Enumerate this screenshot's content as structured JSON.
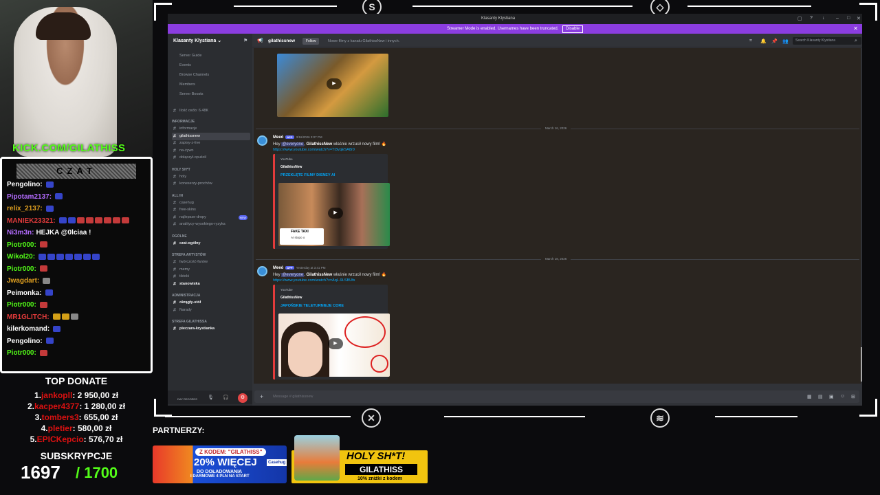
{
  "overlay": {
    "kick_url": "KICK.COM/GILATHISS",
    "chat_title": "CZAT",
    "chat": [
      {
        "user": "Pengolino:",
        "color": "#ffffff",
        "msg": "",
        "emotes": [
          "b"
        ]
      },
      {
        "user": "Pipotam2137:",
        "color": "#b46cff",
        "msg": "",
        "emotes": [
          "b"
        ]
      },
      {
        "user": "relix_2137:",
        "color": "#e0a020",
        "msg": "",
        "emotes": [
          "b"
        ]
      },
      {
        "user": "MANIEK23321:",
        "color": "#e23b3b",
        "msg": "",
        "emotes": [
          "b",
          "b",
          "r",
          "r",
          "r",
          "r",
          "r",
          "r"
        ]
      },
      {
        "user": "Ni3m3n:",
        "color": "#b46cff",
        "msg": "HEJKA @0lciaa !",
        "emotes": []
      },
      {
        "user": "Piotr000:",
        "color": "#53fc18",
        "msg": "",
        "emotes": [
          "r"
        ]
      },
      {
        "user": "Wikol20:",
        "color": "#53fc18",
        "msg": "",
        "emotes": [
          "b",
          "b",
          "b",
          "b",
          "b",
          "b",
          "b"
        ]
      },
      {
        "user": "Piotr000:",
        "color": "#53fc18",
        "msg": "",
        "emotes": [
          "r"
        ]
      },
      {
        "user": "Jwagdart:",
        "color": "#e0a020",
        "msg": "",
        "emotes": [
          "g"
        ]
      },
      {
        "user": "Peimonka:",
        "color": "#ffffff",
        "msg": "",
        "emotes": [
          "b"
        ]
      },
      {
        "user": "Piotr000:",
        "color": "#53fc18",
        "msg": "",
        "emotes": [
          "r"
        ]
      },
      {
        "user": "MR1GLITCH:",
        "color": "#e23b3b",
        "msg": "",
        "emotes": [
          "y",
          "y",
          "g"
        ]
      },
      {
        "user": "kilerkomand:",
        "color": "#ffffff",
        "msg": "",
        "emotes": [
          "b"
        ]
      },
      {
        "user": "Pengolino:",
        "color": "#ffffff",
        "msg": "",
        "emotes": [
          "b"
        ]
      },
      {
        "user": "Piotr000:",
        "color": "#53fc18",
        "msg": "",
        "emotes": [
          "r"
        ]
      }
    ],
    "top_donate_title": "TOP DONATE",
    "donations": [
      {
        "rank": "1.",
        "name": "jankopll",
        "amount": ": 2 950,00 zł"
      },
      {
        "rank": "2.",
        "name": "kacper4377",
        "amount": ": 1 280,00 zł"
      },
      {
        "rank": "3.",
        "name": "tombers3",
        "amount": ": 655,00 zł"
      },
      {
        "rank": "4.",
        "name": "pletier",
        "amount": ": 580,00 zł"
      },
      {
        "rank": "5.",
        "name": "EPICKepcio",
        "amount": ": 576,70 zł"
      }
    ],
    "subs_title": "SUBSKRYPCJE",
    "subs_count": "1697",
    "subs_goal": "/ 1700",
    "partners_label": "PARTNERZY:",
    "banner1": {
      "code": "Z KODEM: \"GILATHISS\"",
      "headline": "20% WIĘCEJ",
      "sub": "DO DOŁADOWANIA",
      "fine": "I DARMOWE 4 PLN NA START",
      "brand": "Casehug"
    },
    "banner2": {
      "headline": "HOLY SH*T!",
      "code": "GILATHISS",
      "fine": "10% zniżki z kodem"
    }
  },
  "discord": {
    "window_title": "Klasanty Klystiana",
    "streamer_notice": "Streamer Mode is enabled. Usernames have been truncated.",
    "disable_label": "Disable",
    "server_name": "Klasanty Klystiana",
    "nav": [
      "Server Guide",
      "Events",
      "Browse Channels",
      "Members",
      "Server Boosts"
    ],
    "member_count": "Ilość osób: 6.48K",
    "categories": {
      "info": "INFORMACJE",
      "holy": "HOLY SH*T",
      "allin": "ALL IN",
      "ogolne": "Ogólne",
      "artysty": "STREFA ARTYSTÓW",
      "admin": "ADMINISTRACJA",
      "gilathiss": "STREFA GILATHISSA"
    },
    "channels_info": [
      "informacje",
      "gilathissnew",
      "zapisy-z-live",
      "na-żywo",
      "dołączył-opuścił"
    ],
    "channels_holy": [
      "holy",
      "koneserzy-prochów"
    ],
    "channels_allin": [
      "casehug",
      "free-skins",
      "najlepsze-dropy",
      "analitycy-wysokiego-ryzyka"
    ],
    "new_badge": "NEW",
    "channels_ogolne": [
      "czat-ogólny"
    ],
    "channels_artysty": [
      "twórczość-fanów",
      "memy",
      "tiktoki",
      "stanowiska"
    ],
    "channels_admin": [
      "okrągły-stół",
      "Narady"
    ],
    "channels_gilathiss": [
      "pieczara-krystianka"
    ],
    "user_label": "DAY RECORDS",
    "channel_header": "gilathissnew",
    "follow_label": "Follow",
    "topic": "Nowe filmy z kanału GilathissNew i innych.",
    "search_placeholder": "Search Klasanty Klystiana",
    "dates": [
      "March 16, 2026",
      "March 18, 2026"
    ],
    "messages": [
      {
        "author": "Meeó",
        "app_tag": "APP",
        "time": "3/16/2026 3:07 PM",
        "mention": "@everyone",
        "channel_bold": "GilathissNew",
        "text": "właśnie wrzucił nowy film!",
        "link": "https://www.youtube.com/watch?v=TI3vqESA8r0",
        "provider": "YouTube",
        "embed_author": "GilathissNew",
        "embed_title": "PRZEKLĘTE FILMY DISNEY AI",
        "thumb_caption": "FAKE TAXI",
        "thumb_sub": "AI stopo o"
      },
      {
        "author": "Meeó",
        "app_tag": "APP",
        "time": "Yesterday at 3:41 PM",
        "mention": "@everyone",
        "channel_bold": "GilathissNew",
        "text": "właśnie wrzucił nowy film!",
        "link": "https://www.youtube.com/watch?v=AqL-9LSBUfs",
        "provider": "YouTube",
        "embed_author": "GilathissNew",
        "embed_title": "JAPOŃSKIE TELETURNIEJE CORE"
      }
    ],
    "input_placeholder": "Message # gilathissnew"
  }
}
